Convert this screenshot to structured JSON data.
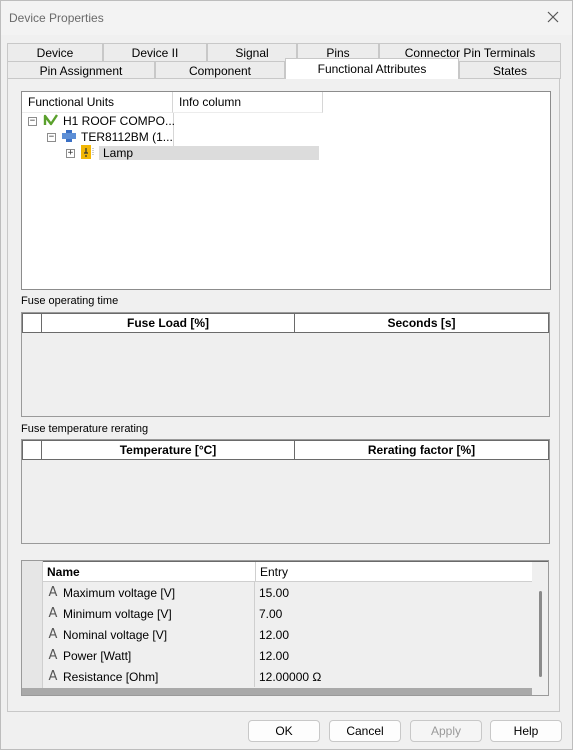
{
  "window": {
    "title": "Device Properties"
  },
  "tabs_row1": [
    {
      "label": "Device"
    },
    {
      "label": "Device II"
    },
    {
      "label": "Signal"
    },
    {
      "label": "Pins"
    },
    {
      "label": "Connector Pin Terminals"
    }
  ],
  "tabs_row2": [
    {
      "label": "Pin Assignment"
    },
    {
      "label": "Component"
    },
    {
      "label": "Functional Attributes",
      "active": true
    },
    {
      "label": "States"
    }
  ],
  "tree": {
    "columns": [
      "Functional Units",
      "Info column"
    ],
    "nodes": [
      {
        "label": "H1 ROOF COMPO...",
        "expander": "−"
      },
      {
        "label": "TER8112BM (1...",
        "expander": "−"
      },
      {
        "label": "Lamp",
        "expander": "+"
      }
    ]
  },
  "fuse_operating_time": {
    "label": "Fuse operating time",
    "columns": [
      "Fuse Load [%]",
      "Seconds [s]"
    ]
  },
  "fuse_temperature": {
    "label": "Fuse temperature rerating",
    "columns": [
      "Temperature [°C]",
      "Rerating factor [%]"
    ]
  },
  "properties": {
    "columns": [
      "Name",
      "Entry"
    ],
    "rows": [
      {
        "name": "Maximum voltage [V]",
        "entry": "15.00"
      },
      {
        "name": "Minimum voltage [V]",
        "entry": "7.00"
      },
      {
        "name": "Nominal voltage [V]",
        "entry": "12.00"
      },
      {
        "name": "Power [Watt]",
        "entry": "12.00"
      },
      {
        "name": "Resistance [Ohm]",
        "entry": "12.00000 Ω"
      }
    ]
  },
  "buttons": {
    "ok": "OK",
    "cancel": "Cancel",
    "apply": "Apply",
    "help": "Help"
  },
  "colors": {
    "accent": "#3a6fc4",
    "lamp_yellow": "#f2b705",
    "functional_green": "#5aa02c"
  }
}
